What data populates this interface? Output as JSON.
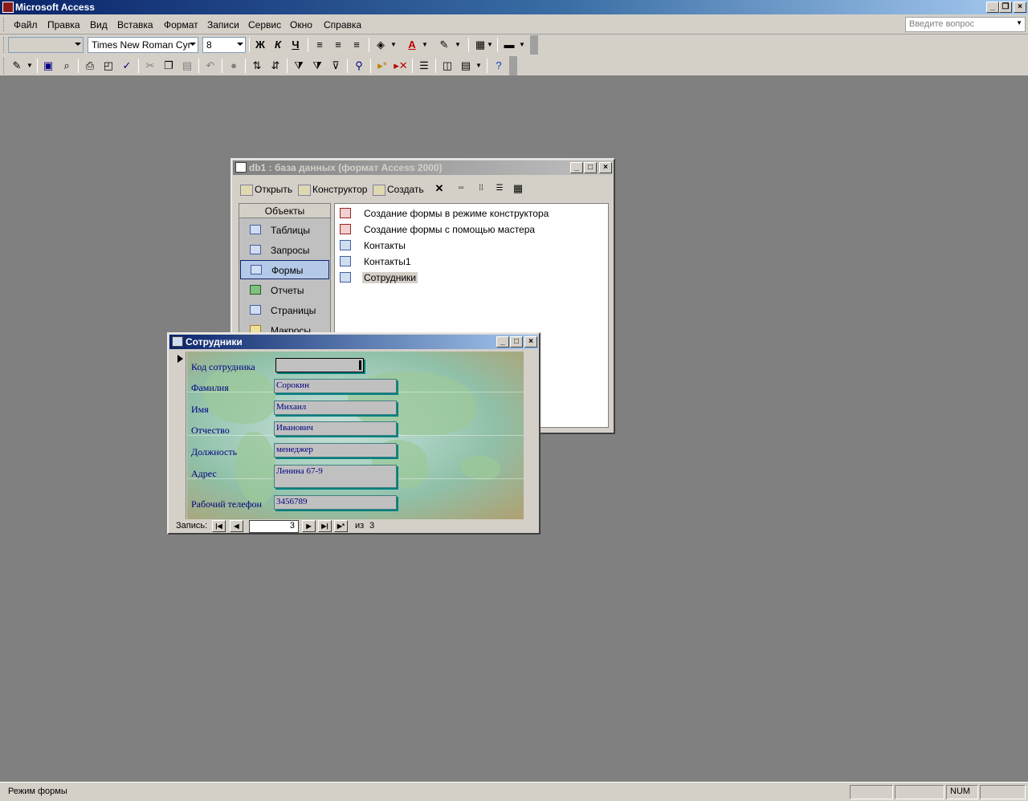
{
  "app": {
    "title": "Microsoft Access"
  },
  "menu": {
    "items": [
      "Файл",
      "Правка",
      "Вид",
      "Вставка",
      "Формат",
      "Записи",
      "Сервис",
      "Окно",
      "Справка"
    ],
    "question_placeholder": "Введите вопрос"
  },
  "format_toolbar": {
    "object_combo": "",
    "font": "Times New Roman Cyr",
    "size": "8",
    "bold": "Ж",
    "italic": "К",
    "underline": "Ч"
  },
  "db_window": {
    "title": "db1 : база данных (формат Access 2000)",
    "toolbar": {
      "open": "Открыть",
      "design": "Конструктор",
      "create": "Создать"
    },
    "objects_header": "Объекты",
    "objects": [
      "Таблицы",
      "Запросы",
      "Формы",
      "Отчеты",
      "Страницы",
      "Макросы"
    ],
    "selected_object": "Формы",
    "list": [
      "Создание формы в режиме конструктора",
      "Создание формы с помощью мастера",
      "Контакты",
      "Контакты1",
      "Сотрудники"
    ]
  },
  "form_window": {
    "title": "Сотрудники",
    "fields": [
      {
        "label": "Код сотрудника",
        "value": ""
      },
      {
        "label": "Фамилия",
        "value": "Сорокин"
      },
      {
        "label": "Имя",
        "value": "Михаил"
      },
      {
        "label": "Отчество",
        "value": "Иванович"
      },
      {
        "label": "Должность",
        "value": "менеджер"
      },
      {
        "label": "Адрес",
        "value": "Ленина 67-9"
      },
      {
        "label": "Рабочий телефон",
        "value": "3456789"
      }
    ],
    "nav": {
      "label": "Запись:",
      "current": "3",
      "of_label": "из",
      "total": "3"
    }
  },
  "status": {
    "text": "Режим формы",
    "num": "NUM"
  }
}
